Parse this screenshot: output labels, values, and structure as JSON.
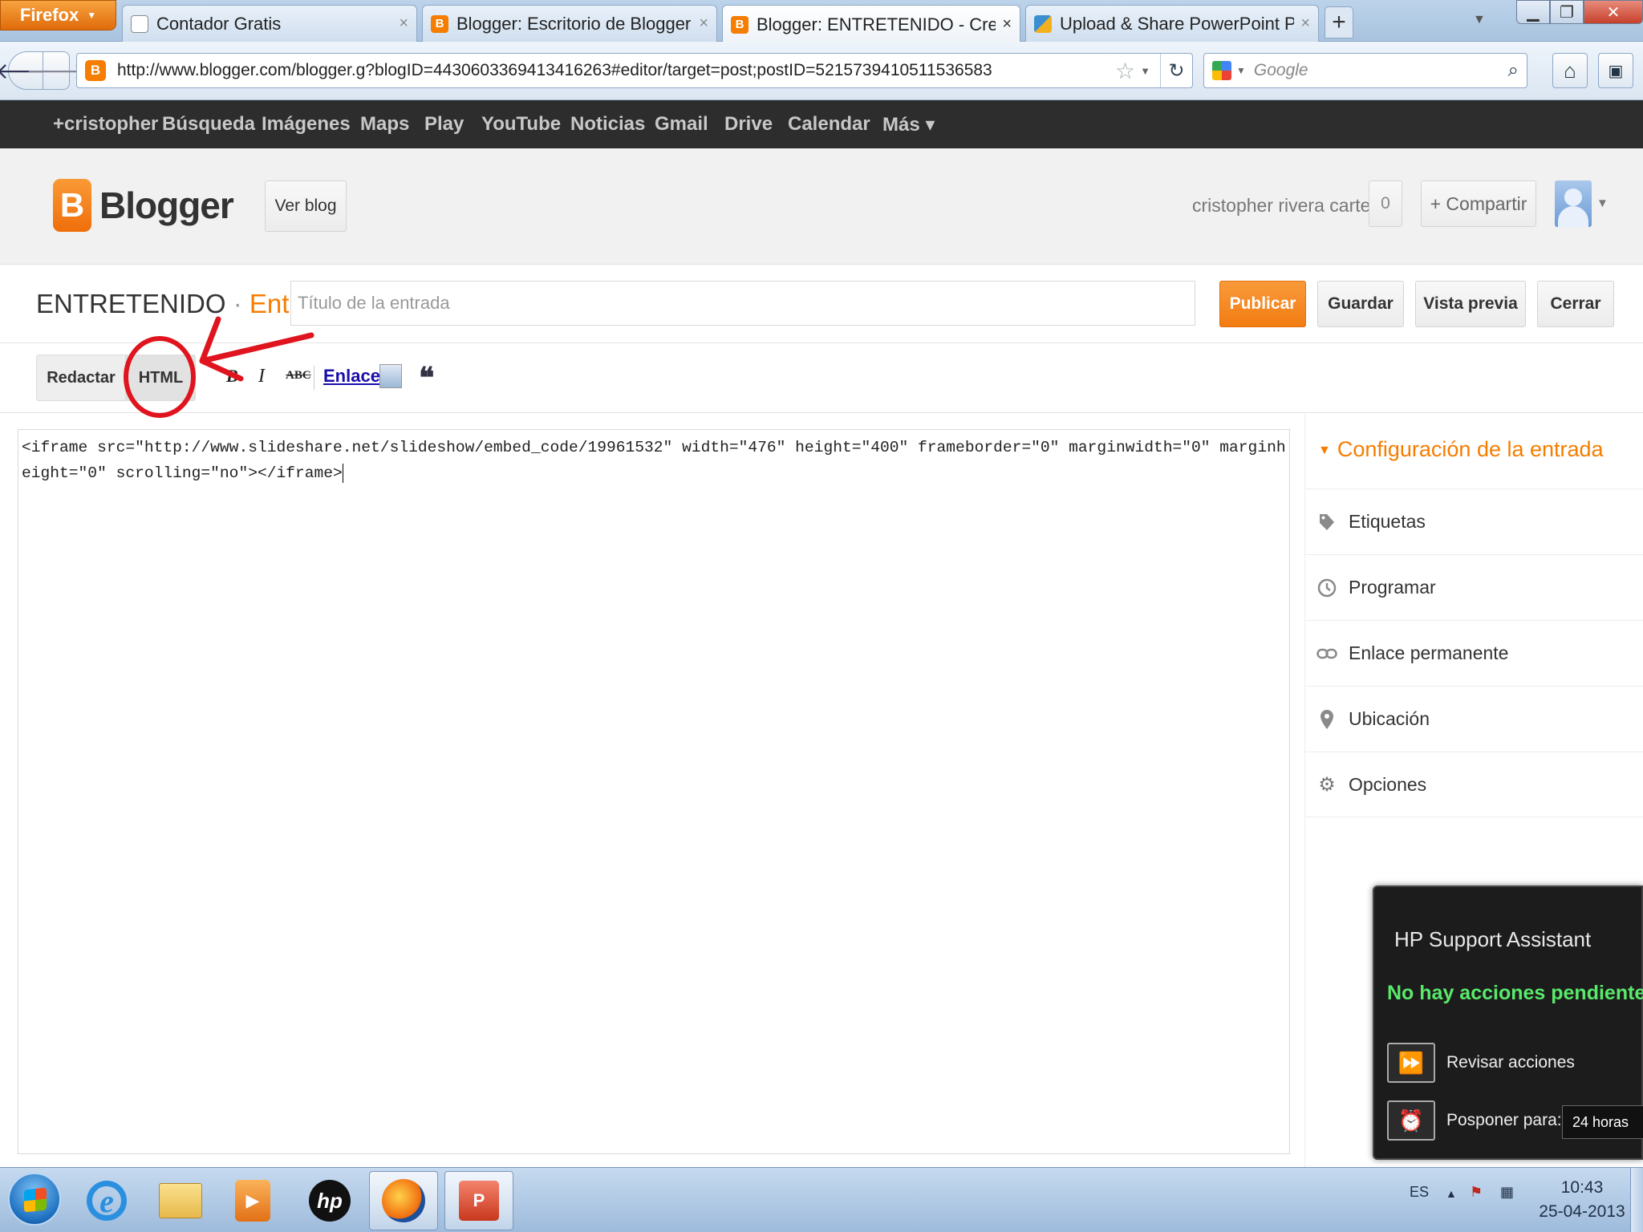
{
  "browser": {
    "menu_label": "Firefox",
    "tabs": [
      {
        "title": "Contador Gratis",
        "favicon": "document-icon"
      },
      {
        "title": "Blogger: Escritorio de Blogger",
        "favicon": "blogger-icon"
      },
      {
        "title": "Blogger: ENTRETENIDO - Crear entrada",
        "favicon": "blogger-icon",
        "active": true
      },
      {
        "title": "Upload & Share PowerPoint Presenta...",
        "favicon": "slideshare-icon"
      }
    ],
    "new_tab_label": "+",
    "url": "http://www.blogger.com/blogger.g?blogID=4430603369413416263#editor/target=post;postID=5215739410511536583",
    "search_placeholder": "Google"
  },
  "google_bar": {
    "items": [
      "+cristopher",
      "Búsqueda",
      "Imágenes",
      "Maps",
      "Play",
      "YouTube",
      "Noticias",
      "Gmail",
      "Drive",
      "Calendar",
      "Más ▾"
    ]
  },
  "blogger_header": {
    "logo_text": "Blogger",
    "view_blog_label": "Ver blog",
    "username": "cristopher rivera cartes",
    "notifications_count": "0",
    "share_label": "+  Compartir"
  },
  "post": {
    "blog_name": "ENTRETENIDO",
    "separator": "·",
    "mode_label": "Entrada",
    "title_placeholder": "Título de la entrada",
    "buttons": {
      "publish": "Publicar",
      "save": "Guardar",
      "preview": "Vista previa",
      "close": "Cerrar"
    }
  },
  "toolbar": {
    "compose_label": "Redactar",
    "html_label": "HTML",
    "bold": "B",
    "italic": "I",
    "strike": "ABC",
    "link_label": "Enlace",
    "quote": "❝"
  },
  "editor": {
    "content": "<iframe src=\"http://www.slideshare.net/slideshow/embed_code/19961532\" width=\"476\" height=\"400\" frameborder=\"0\" marginwidth=\"0\" marginheight=\"0\" scrolling=\"no\"></iframe>"
  },
  "sidebar": {
    "heading": "Configuración de la entrada",
    "items": [
      {
        "label": "Etiquetas",
        "icon": "tag-icon"
      },
      {
        "label": "Programar",
        "icon": "clock-icon"
      },
      {
        "label": "Enlace permanente",
        "icon": "link-icon"
      },
      {
        "label": "Ubicación",
        "icon": "location-pin-icon"
      },
      {
        "label": "Opciones",
        "icon": "gear-icon"
      }
    ]
  },
  "hp_popup": {
    "title": "HP Support Assistant",
    "status": "No hay acciones pendientes.",
    "review_label": "Revisar acciones",
    "postpone_label": "Posponer para:",
    "postpone_value": "24 horas"
  },
  "taskbar": {
    "language": "ES",
    "time": "10:43",
    "date": "25-04-2013"
  },
  "colors": {
    "accent": "#f57d00",
    "annotation": "#e0141e",
    "hp_status": "#59e96a"
  }
}
